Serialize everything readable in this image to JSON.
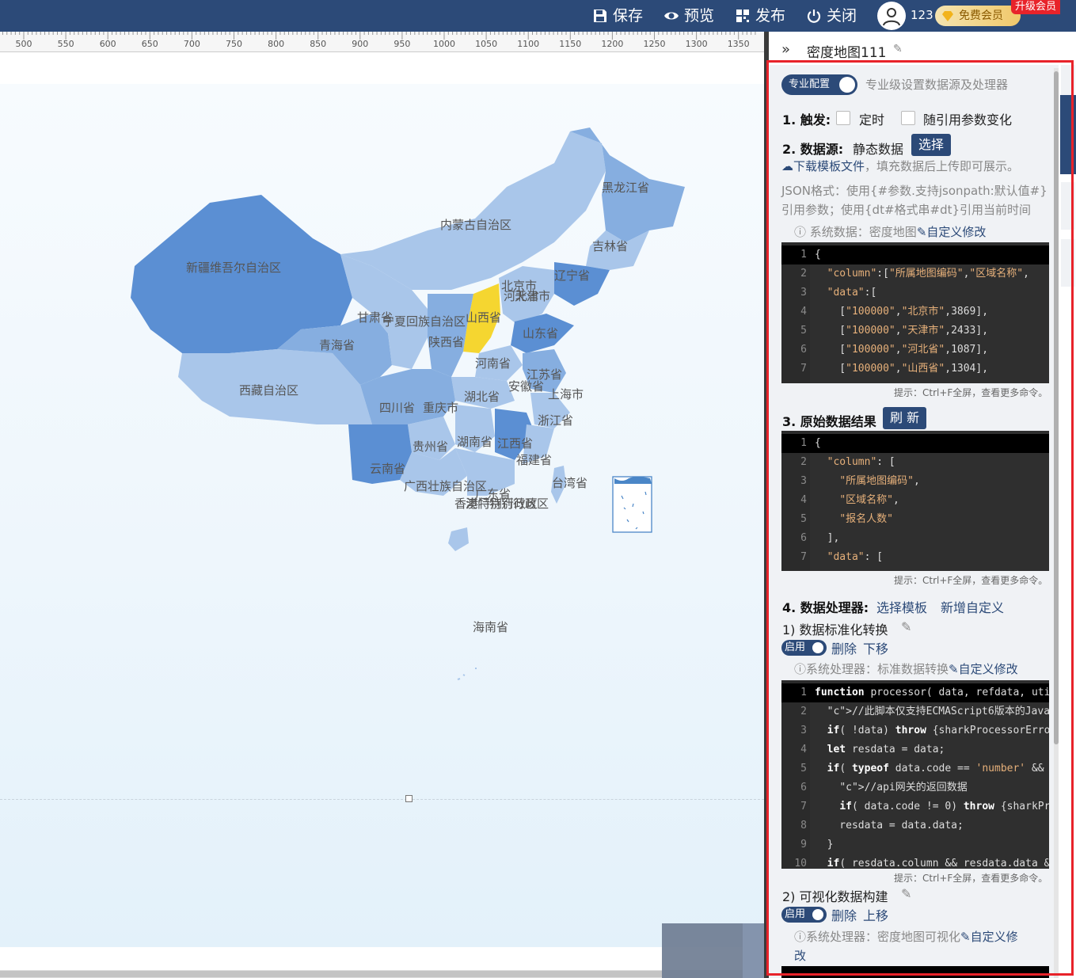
{
  "toolbar": {
    "save": "保存",
    "preview": "预览",
    "publish": "发布",
    "close": "关闭",
    "username": "123",
    "vip_label": "免费会员",
    "upgrade_label": "升级会员"
  },
  "ruler": {
    "labels": [
      "500",
      "550",
      "600",
      "650",
      "700",
      "750",
      "800",
      "850",
      "900",
      "950",
      "1000",
      "1050",
      "1100",
      "1150",
      "1200",
      "1250",
      "1300",
      "1350"
    ]
  },
  "map": {
    "provinces": [
      "黑龙江省",
      "内蒙古自治区",
      "吉林省",
      "新疆维吾尔自治区",
      "辽宁省",
      "北京市",
      "天津市",
      "河北省",
      "甘肃省",
      "宁夏回族自治区",
      "山西省",
      "青海省",
      "陕西省",
      "山东省",
      "河南省",
      "江苏省",
      "西藏自治区",
      "安徽省",
      "上海市",
      "湖北省",
      "四川省",
      "重庆市",
      "浙江省",
      "贵州省",
      "湖南省",
      "江西省",
      "福建省",
      "云南省",
      "广西壮族自治区",
      "台湾省",
      "广东省",
      "香港特别行政区",
      "澳门特别行政区",
      "海南省"
    ],
    "colors": {
      "dark": "#5b8fd3",
      "mid": "#86aee0",
      "light": "#a9c6ea",
      "highlight": "#f5d630"
    }
  },
  "panel": {
    "title": "密度地图111",
    "pro_toggle": "专业配置",
    "pro_desc": "专业级设置数据源及处理器",
    "trigger_label": "1. 触发:",
    "trigger_timed": "定时",
    "trigger_param": "随引用参数变化",
    "datasource_label": "2. 数据源:",
    "datasource_value": "静态数据",
    "select_btn": "选择",
    "download_link": "下载模板文件",
    "download_suffix": "，填充数据后上传即可展示。",
    "json_note": "JSON格式：使用{#参数.支持jsonpath:默认值#}引用参数；使用{dt#格式串#dt}引用当前时间",
    "system_data": "系统数据：密度地图",
    "custom_modify": "自定义修改",
    "hint": "提示：Ctrl+F全屏，查看更多命令。",
    "raw_label": "3. 原始数据结果",
    "refresh_btn": "刷 新",
    "processor_label": "4. 数据处理器:",
    "select_template": "选择模板",
    "add_custom": "新增自定义",
    "proc1_title": "1)  数据标准化转换",
    "enable": "启用",
    "delete": "删除",
    "move_down": "下移",
    "move_up": "上移",
    "proc1_system": "系统处理器：标准数据转换",
    "proc2_title": "2)  可视化数据构建",
    "proc2_system": "系统处理器：密度地图可视化",
    "custom_modify2": "自定义修",
    "custom_modify2_tail": "改"
  },
  "code1": {
    "lines": [
      "{",
      "  \"column\":[\"所属地图编码\",\"区域名称\",",
      "  \"data\":[",
      "    [\"100000\",\"北京市\",3869],",
      "    [\"100000\",\"天津市\",2433],",
      "    [\"100000\",\"河北省\",1087],",
      "    [\"100000\",\"山西省\",1304],"
    ]
  },
  "code2": {
    "lines": [
      "{",
      "  \"column\": [",
      "    \"所属地图编码\",",
      "    \"区域名称\",",
      "    \"报名人数\"",
      "  ],",
      "  \"data\": ["
    ]
  },
  "code3": {
    "lines": [
      "function processor( data, refdata, uti",
      "  //此脚本仅支持ECMAScript6版本的JavaS",
      "  if( !data) throw {sharkProcessorErro",
      "  let resdata = data;",
      "  if( typeof data.code == 'number' &&",
      "    //api网关的返回数据",
      "    if( data.code != 0) throw {sharkPr",
      "    resdata = data.data;",
      "  }",
      "  if( resdata.column && resdata.data &"
    ]
  }
}
